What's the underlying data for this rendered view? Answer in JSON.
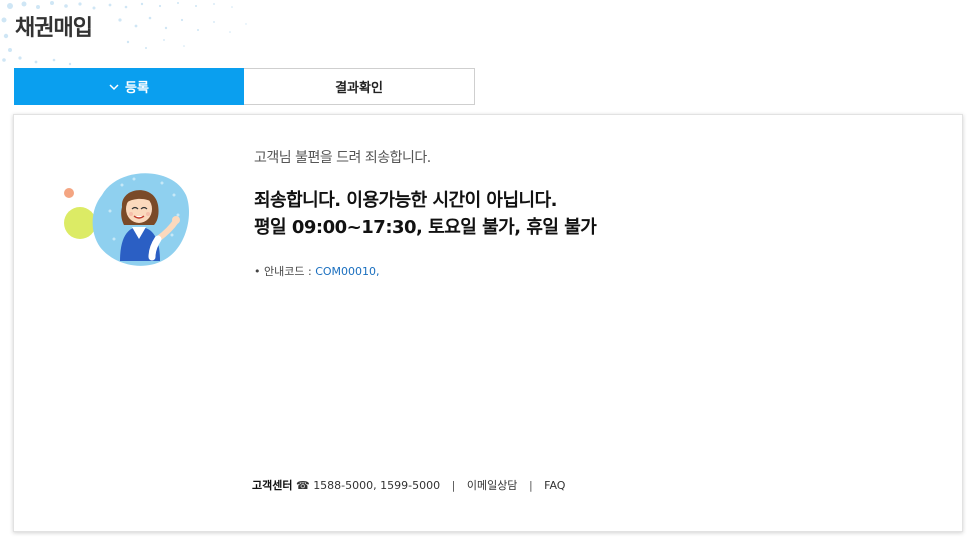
{
  "page": {
    "title": "채권매입"
  },
  "tabs": [
    {
      "label": "등록",
      "active": true
    },
    {
      "label": "결과확인",
      "active": false
    }
  ],
  "notice": {
    "apology": "고객님 불편을 드려 죄송합니다.",
    "headline_line1": "죄송합니다. 이용가능한 시간이 아닙니다.",
    "headline_line2": "평일 09:00~17:30, 토요일 불가, 휴일 불가",
    "code_bullet": "•",
    "code_label": "안내코드 :",
    "code_value": "COM00010,"
  },
  "footer": {
    "center_label": "고객센터",
    "phone_icon": "phone-icon",
    "phone_numbers": "1588-5000, 1599-5000",
    "separator": "|",
    "email_link": "이메일상담",
    "faq_link": "FAQ"
  },
  "colors": {
    "accent": "#0a9fef",
    "link": "#1a6fbf"
  },
  "icons": {
    "tab_chevron": "chevron-down-icon",
    "illustration": "customer-service-agent-illustration"
  }
}
